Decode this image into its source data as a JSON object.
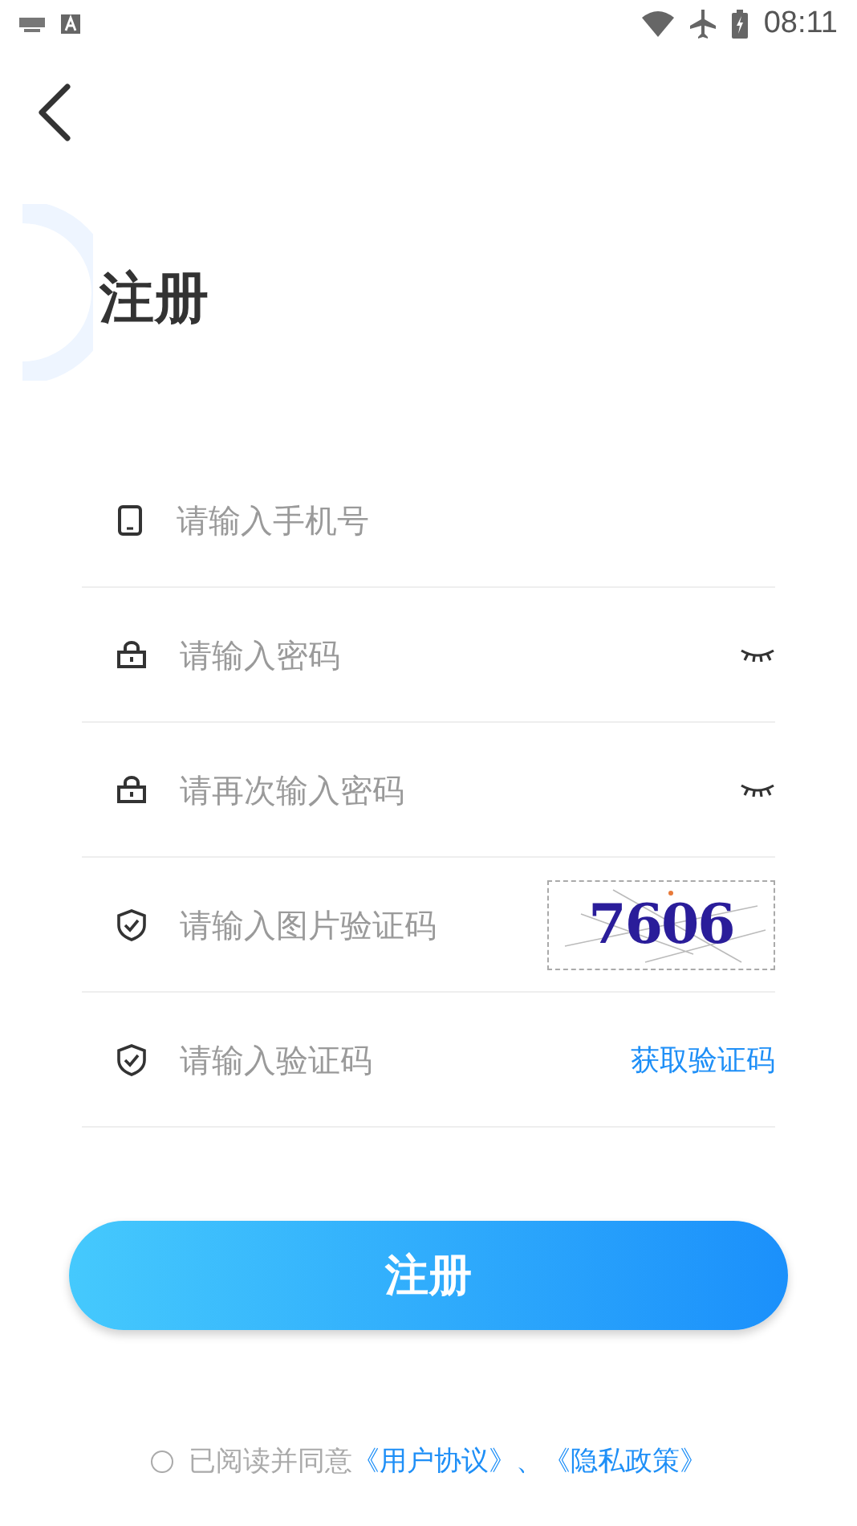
{
  "status_bar": {
    "time": "08:11"
  },
  "title": "注册",
  "fields": [
    {
      "kind": "phone",
      "placeholder": "请输入手机号"
    },
    {
      "kind": "password",
      "placeholder": "请输入密码",
      "accessory": {
        "kind": "eye"
      }
    },
    {
      "kind": "password",
      "placeholder": "请再次输入密码",
      "accessory": {
        "kind": "eye"
      }
    },
    {
      "kind": "captcha",
      "placeholder": "请输入图片验证码",
      "accessory": {
        "kind": "captcha",
        "code": "7606"
      }
    },
    {
      "kind": "code",
      "placeholder": "请输入验证码",
      "accessory": {
        "kind": "link",
        "label": "获取验证码"
      }
    }
  ],
  "submit_button": "注册",
  "agreement": {
    "checked": false,
    "text": "已阅读并同意",
    "links": [
      "《用户协议》",
      "《隐私政策》"
    ],
    "separator": "、"
  }
}
